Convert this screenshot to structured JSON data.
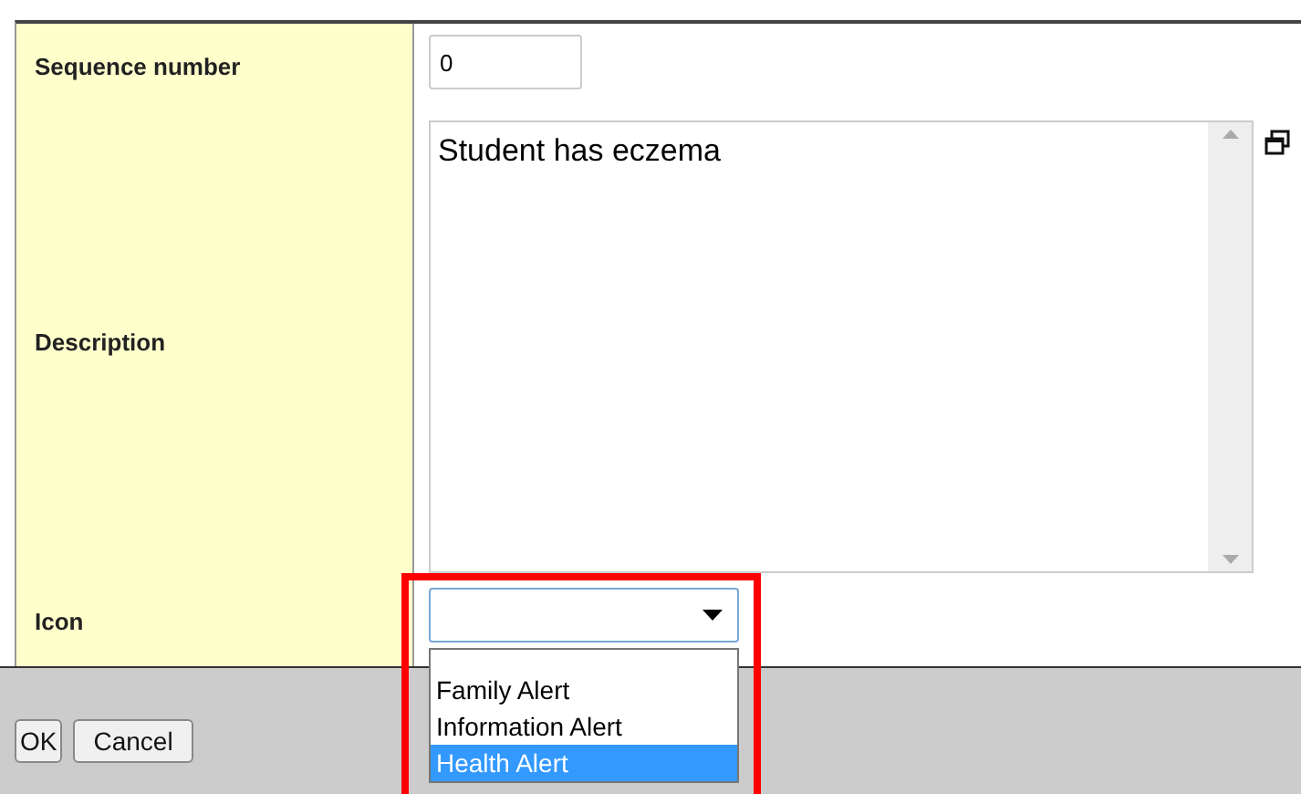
{
  "form": {
    "rows": [
      {
        "kind": "text",
        "label": "Sequence number",
        "value": "0"
      },
      {
        "kind": "textarea",
        "label": "Description",
        "value": "Student has eczema"
      },
      {
        "kind": "select",
        "label": "Icon",
        "value": "",
        "expanded": true,
        "options": [
          {
            "label": "Family Alert",
            "selected": false
          },
          {
            "label": "Information Alert",
            "selected": false
          },
          {
            "label": "Health Alert",
            "selected": true
          }
        ]
      }
    ]
  },
  "buttons": [
    "OK",
    "Cancel"
  ]
}
